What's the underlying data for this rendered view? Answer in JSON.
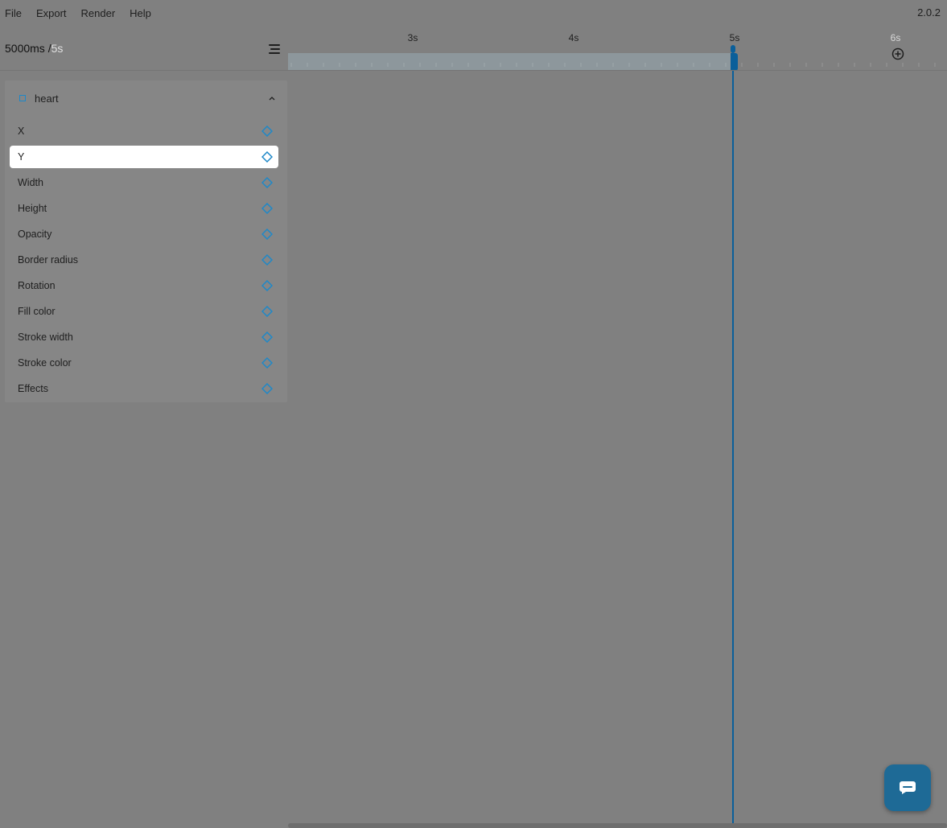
{
  "menu": {
    "items": [
      "File",
      "Export",
      "Render",
      "Help"
    ],
    "version": "2.0.2"
  },
  "time": {
    "current": "5000ms /",
    "total": "5s"
  },
  "ruler": {
    "ticks": [
      "3s",
      "4s",
      "5s",
      "6s"
    ]
  },
  "layer": {
    "name": "heart",
    "properties": [
      {
        "label": "X",
        "selected": false
      },
      {
        "label": "Y",
        "selected": true
      },
      {
        "label": "Width",
        "selected": false
      },
      {
        "label": "Height",
        "selected": false
      },
      {
        "label": "Opacity",
        "selected": false
      },
      {
        "label": "Border radius",
        "selected": false
      },
      {
        "label": "Rotation",
        "selected": false
      },
      {
        "label": "Fill color",
        "selected": false
      },
      {
        "label": "Stroke width",
        "selected": false
      },
      {
        "label": "Stroke color",
        "selected": false
      },
      {
        "label": "Effects",
        "selected": false
      }
    ]
  },
  "colors": {
    "accent": "#1e88c8",
    "playhead": "#0a5f9a",
    "background": "#808080"
  },
  "icons": {
    "collapse": "list-collapse-icon",
    "add": "plus-circle-icon",
    "keyframe": "diamond-icon",
    "chat": "chat-icon"
  }
}
